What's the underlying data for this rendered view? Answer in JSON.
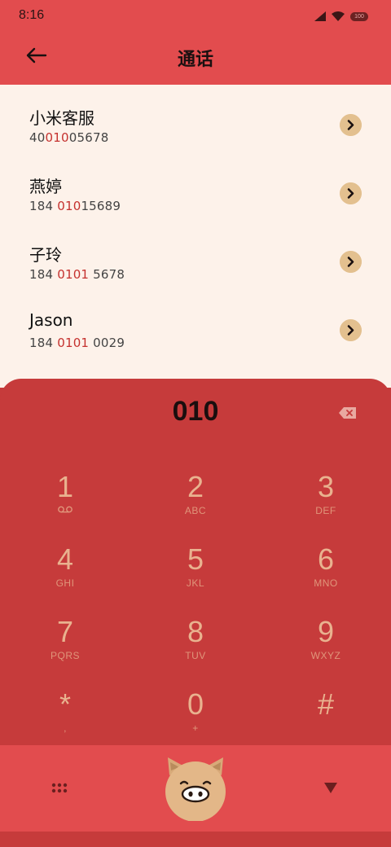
{
  "status_bar": {
    "time": "8:16",
    "battery": "100"
  },
  "header": {
    "title": "通话"
  },
  "contacts": [
    {
      "name": "小米客服",
      "num_pre": "40",
      "num_hl": "010",
      "num_post": "05678"
    },
    {
      "name": "燕婷",
      "num_pre": "184 ",
      "num_hl": "010",
      "num_post": "15689"
    },
    {
      "name": "子玲",
      "num_pre": "184 ",
      "num_hl": "0101",
      "num_post": " 5678"
    },
    {
      "name": "Jason",
      "num_pre": "184 ",
      "num_hl": "0101",
      "num_post": " 0029"
    }
  ],
  "dialer": {
    "input": "010",
    "keys": [
      {
        "digit": "1",
        "letters": ""
      },
      {
        "digit": "2",
        "letters": "ABC"
      },
      {
        "digit": "3",
        "letters": "DEF"
      },
      {
        "digit": "4",
        "letters": "GHI"
      },
      {
        "digit": "5",
        "letters": "JKL"
      },
      {
        "digit": "6",
        "letters": "MNO"
      },
      {
        "digit": "7",
        "letters": "PQRS"
      },
      {
        "digit": "8",
        "letters": "TUV"
      },
      {
        "digit": "9",
        "letters": "WXYZ"
      },
      {
        "digit": "*",
        "letters": ","
      },
      {
        "digit": "0",
        "letters": "+"
      },
      {
        "digit": "#",
        "letters": ""
      }
    ]
  },
  "colors": {
    "header": "#e24c4e",
    "list_bg": "#fdf2ea",
    "highlight": "#c5322f",
    "pad": "#c63b3b",
    "key": "#e9b28f",
    "arrow_bg": "#e3c08f"
  },
  "icons": {
    "back": "arrow-left-icon",
    "delete": "backspace-icon",
    "keypad": "keypad-grid-icon",
    "call": "pig-call-icon",
    "collapse": "triangle-down-icon"
  }
}
